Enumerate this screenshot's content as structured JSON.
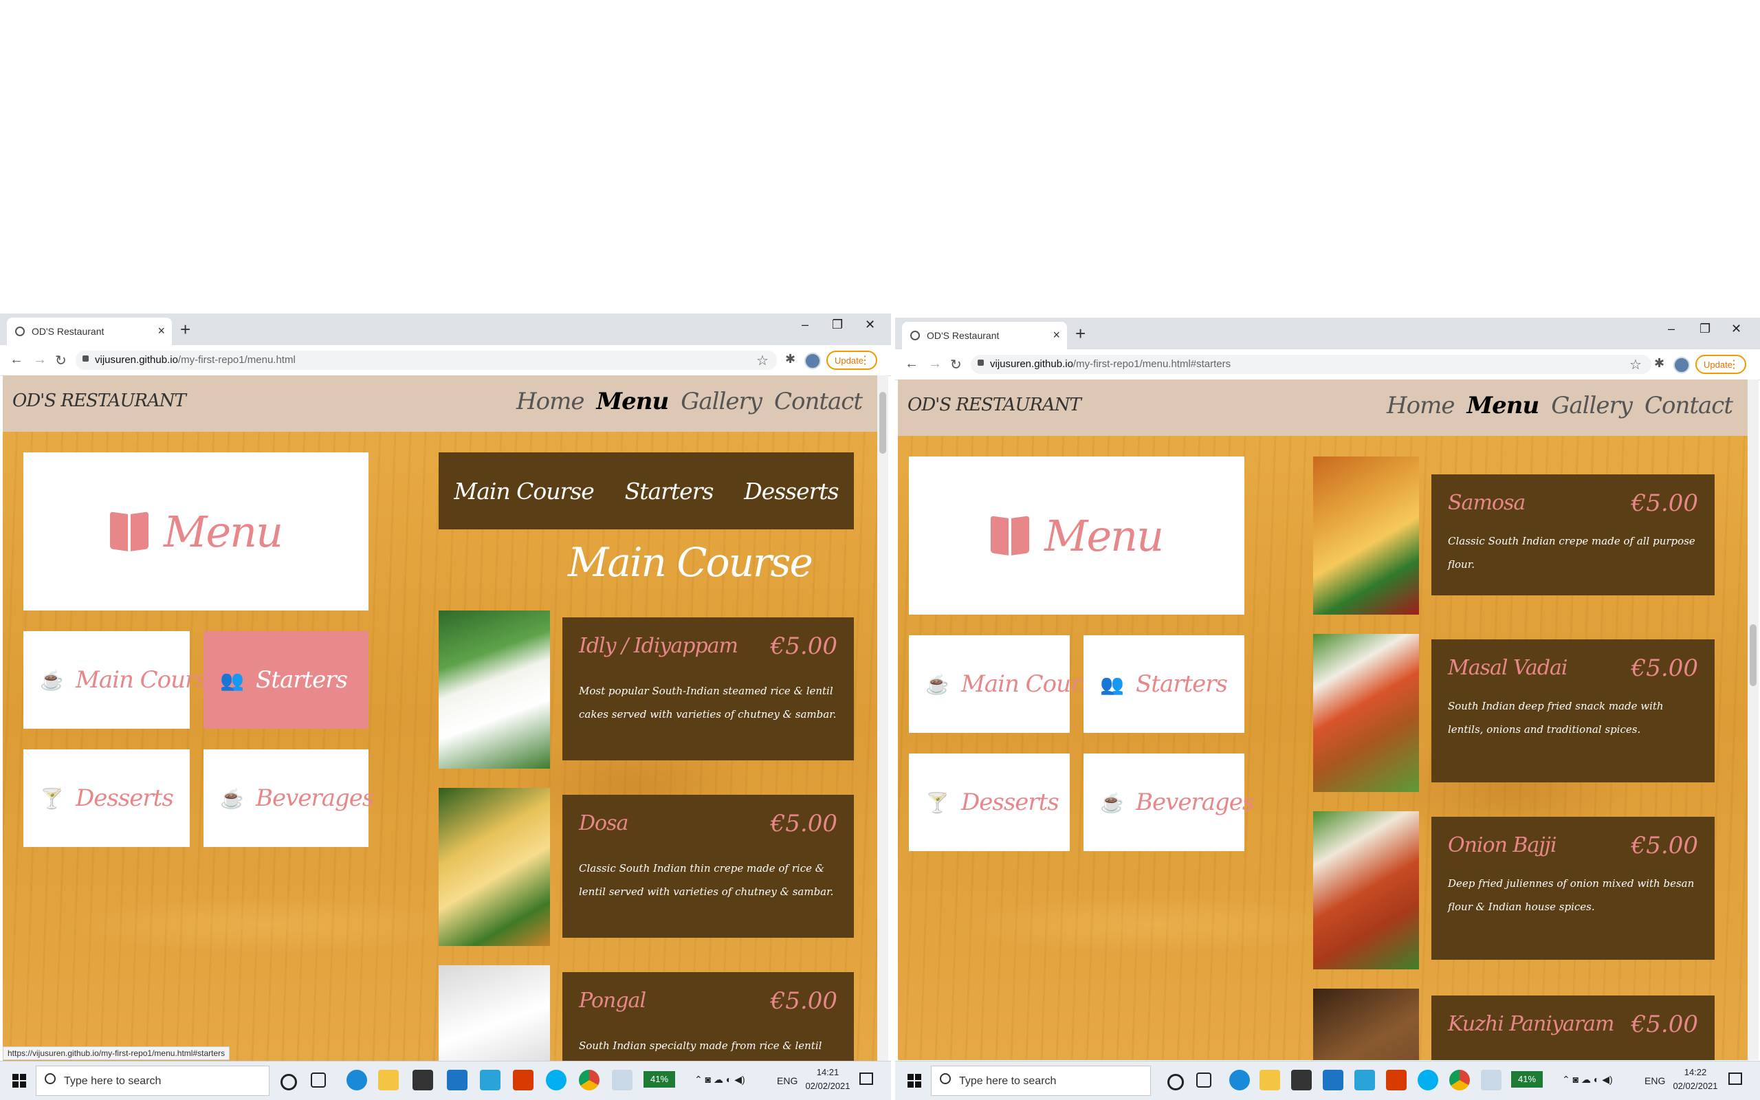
{
  "left": {
    "browser": {
      "tab_title": "OD'S Restaurant",
      "url_domain": "vijusuren.github.io",
      "url_path": "/my-first-repo1/menu.html",
      "update_label": "Update",
      "status_url": "https://vijusuren.github.io/my-first-repo1/menu.html#starters"
    },
    "site": {
      "brand": "OD'S RESTAURANT",
      "nav": [
        "Home",
        "Menu",
        "Gallery",
        "Contact"
      ],
      "hero_label": "Menu",
      "categories": [
        "Main Course",
        "Starters",
        "Desserts",
        "Beverages"
      ],
      "section_tabs": [
        "Main Course",
        "Starters",
        "Desserts"
      ],
      "section_title": "Main Course",
      "dishes": [
        {
          "name": "Idly / Idiyappam",
          "price": "€5.00",
          "desc": "Most popular South-Indian steamed rice & lentil cakes served with varieties of chutney & sambar."
        },
        {
          "name": "Dosa",
          "price": "€5.00",
          "desc": "Classic South Indian thin crepe made of rice & lentil served with varieties of chutney & sambar."
        },
        {
          "name": "Pongal",
          "price": "€5.00",
          "desc": "South Indian specialty made from rice & lentil cooked served"
        }
      ]
    },
    "taskbar": {
      "search_placeholder": "Type here to search",
      "battery": "41%",
      "lang": "ENG",
      "time": "14:21",
      "date": "02/02/2021"
    }
  },
  "right": {
    "browser": {
      "tab_title": "OD'S Restaurant",
      "url_domain": "vijusuren.github.io",
      "url_path": "/my-first-repo1/menu.html#starters",
      "update_label": "Update"
    },
    "site": {
      "brand": "OD'S RESTAURANT",
      "nav": [
        "Home",
        "Menu",
        "Gallery",
        "Contact"
      ],
      "hero_label": "Menu",
      "categories": [
        "Main Course",
        "Starters",
        "Desserts",
        "Beverages"
      ],
      "dishes": [
        {
          "name": "Samosa",
          "price": "€5.00",
          "desc": "Classic South Indian crepe made of all purpose flour."
        },
        {
          "name": "Masal Vadai",
          "price": "€5.00",
          "desc": "South Indian deep fried snack made with lentils, onions and traditional spices."
        },
        {
          "name": "Onion Bajji",
          "price": "€5.00",
          "desc": "Deep fried juliennes of onion mixed with besan flour & Indian house spices."
        },
        {
          "name": "Kuzhi Paniyaram",
          "price": "€5.00",
          "desc": ""
        }
      ]
    },
    "taskbar": {
      "search_placeholder": "Type here to search",
      "battery": "41%",
      "lang": "ENG",
      "time": "14:22",
      "date": "02/02/2021"
    }
  },
  "colors": {
    "accent_pink": "#e8878a",
    "card_brown": "#5a3f16",
    "header_beige": "#dcc8b4",
    "wood": "#e3a642"
  }
}
